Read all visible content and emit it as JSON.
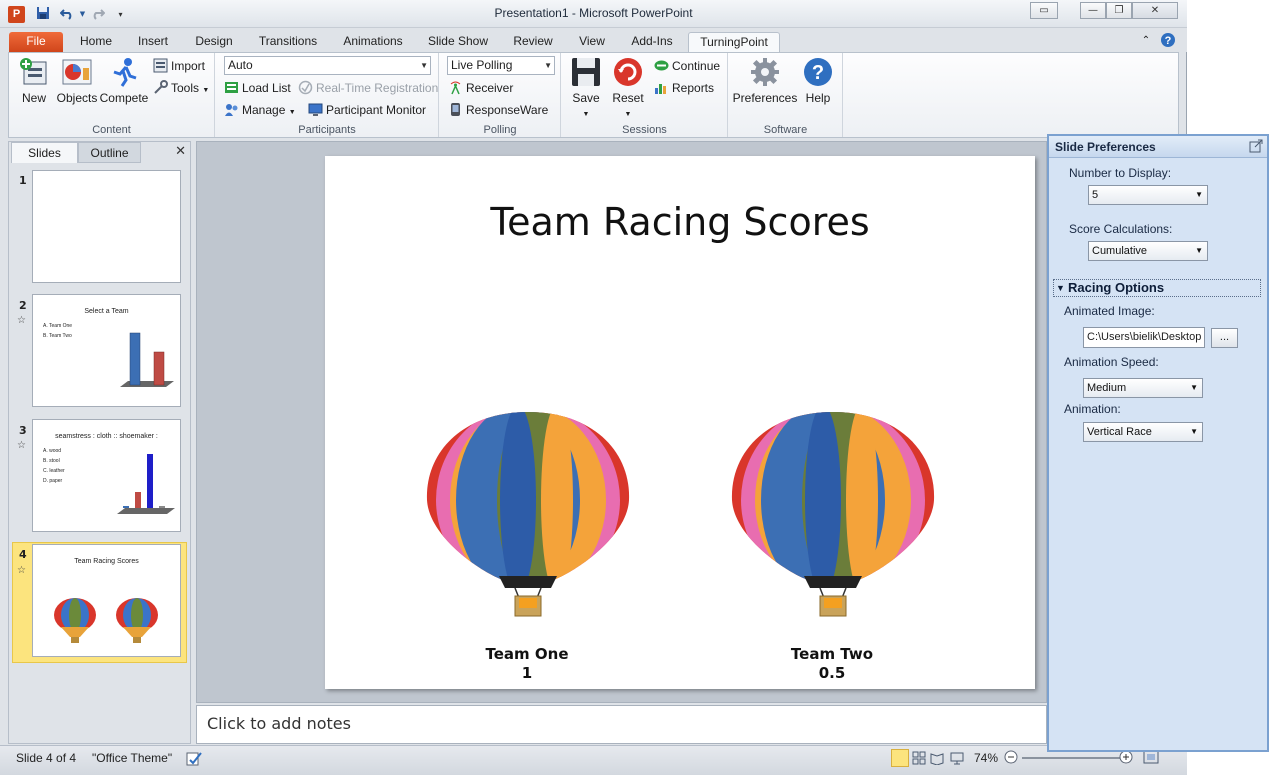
{
  "title_bar": {
    "app_letter": "P",
    "title": "Presentation1  -  Microsoft PowerPoint"
  },
  "tabs": [
    "File",
    "Home",
    "Insert",
    "Design",
    "Transitions",
    "Animations",
    "Slide Show",
    "Review",
    "View",
    "Add-Ins",
    "TurningPoint"
  ],
  "ribbon": {
    "content": {
      "label": "Content",
      "new": "New",
      "objects": "Objects",
      "compete": "Compete",
      "import": "Import",
      "tools": "Tools"
    },
    "participants": {
      "label": "Participants",
      "list_value": "Auto",
      "load_list": "Load List",
      "realtime": "Real-Time Registration",
      "manage": "Manage",
      "monitor": "Participant Monitor"
    },
    "polling": {
      "label": "Polling",
      "mode": "Live Polling",
      "receiver": "Receiver",
      "responseware": "ResponseWare"
    },
    "sessions": {
      "label": "Sessions",
      "save": "Save",
      "reset": "Reset",
      "continue": "Continue",
      "reports": "Reports"
    },
    "software": {
      "label": "Software",
      "preferences": "Preferences",
      "help": "Help"
    }
  },
  "slides_pane": {
    "tab_slides": "Slides",
    "tab_outline": "Outline",
    "thumbs": [
      {
        "num": "1"
      },
      {
        "num": "2",
        "title": "Select a Team",
        "lines": [
          "A. Team One",
          "B. Team Two"
        ]
      },
      {
        "num": "3",
        "title": "seamstress : cloth :: shoemaker :",
        "lines": [
          "A. wood",
          "B. stool",
          "C. leather",
          "D. paper"
        ]
      },
      {
        "num": "4",
        "title": "Team  Racing Scores"
      }
    ]
  },
  "slide": {
    "title": "Team Racing Scores",
    "teams": [
      {
        "name": "Team One",
        "score": "1"
      },
      {
        "name": "Team Two",
        "score": "0.5"
      }
    ]
  },
  "notes": {
    "placeholder": "Click to add notes"
  },
  "status_bar": {
    "slide_info": "Slide 4 of 4",
    "theme": "\"Office Theme\"",
    "zoom": "74%"
  },
  "task_pane": {
    "title": "Slide Preferences",
    "number_label": "Number to Display:",
    "number_value": "5",
    "calc_label": "Score Calculations:",
    "calc_value": "Cumulative",
    "racing_header": "Racing Options",
    "image_label": "Animated Image:",
    "image_path": "C:\\Users\\bielik\\Desktop",
    "browse": "...",
    "speed_label": "Animation Speed:",
    "speed_value": "Medium",
    "anim_label": "Animation:",
    "anim_value": "Vertical Race"
  },
  "colors": {
    "file_tab": "#d0451b",
    "task_pane_bg": "#d5e3f4",
    "selected_thumb": "#fce47e"
  }
}
